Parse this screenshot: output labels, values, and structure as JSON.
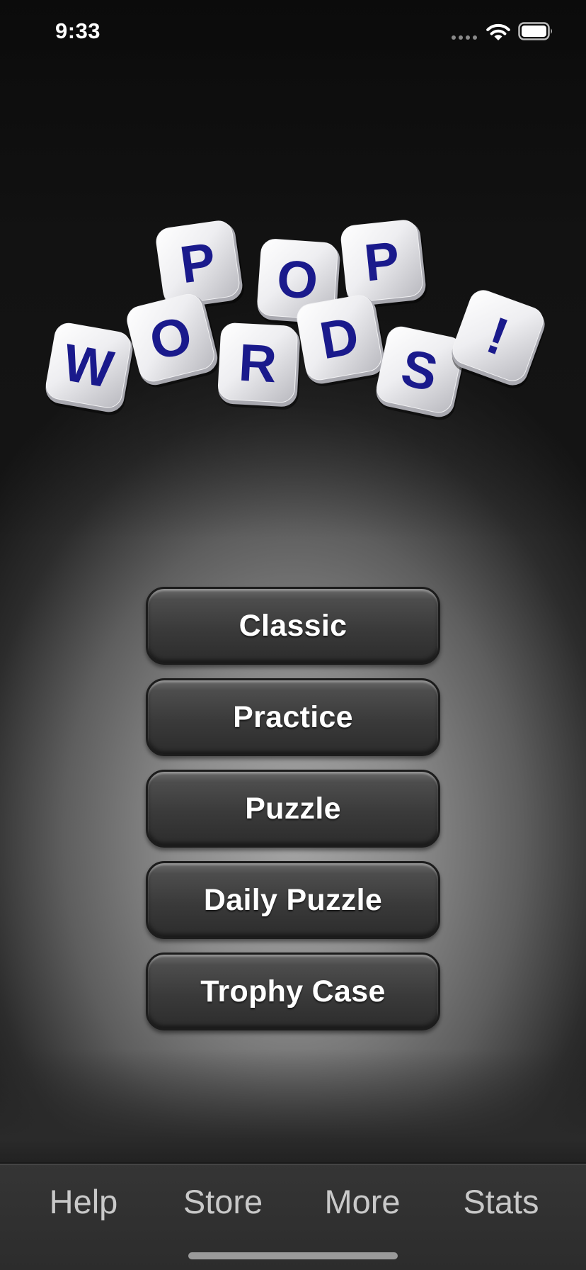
{
  "status_bar": {
    "time": "9:33",
    "icons": [
      "cellular-signal-icon",
      "wifi-icon",
      "battery-icon"
    ]
  },
  "logo": {
    "line1": [
      "P",
      "O",
      "P"
    ],
    "line2": [
      "W",
      "O",
      "R",
      "D",
      "S",
      "!"
    ],
    "letter_color": "#1a1a8c",
    "tile_color": "#f2f2f4"
  },
  "menu": {
    "buttons": [
      {
        "label": "Classic"
      },
      {
        "label": "Practice"
      },
      {
        "label": "Puzzle"
      },
      {
        "label": "Daily Puzzle"
      },
      {
        "label": "Trophy Case"
      }
    ]
  },
  "tab_bar": {
    "items": [
      {
        "label": "Help"
      },
      {
        "label": "Store"
      },
      {
        "label": "More"
      },
      {
        "label": "Stats"
      }
    ]
  }
}
